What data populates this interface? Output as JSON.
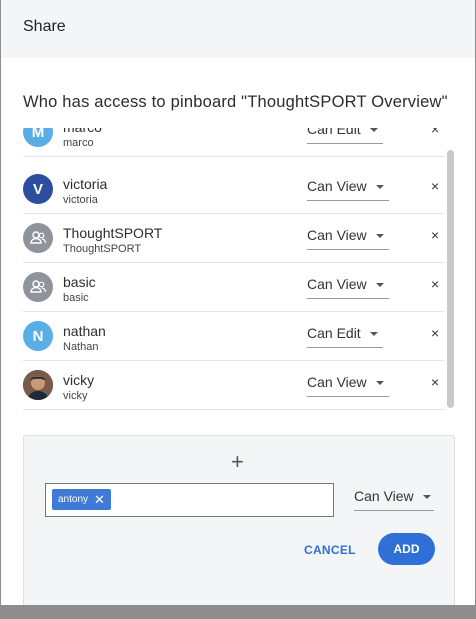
{
  "header": {
    "title": "Share"
  },
  "access_heading": "Who has access to  pinboard \"ThoughtSPORT Overview\"",
  "users": [
    {
      "name": "marco",
      "subname": "marco",
      "avatar_type": "initial",
      "initial": "M",
      "avatar_color": "#5aaee6",
      "permission": "Can Edit"
    },
    {
      "name": "victoria",
      "subname": "victoria",
      "avatar_type": "initial",
      "initial": "V",
      "avatar_color": "#2d4e9e",
      "permission": "Can View"
    },
    {
      "name": "ThoughtSPORT",
      "subname": "ThoughtSPORT",
      "avatar_type": "group-icon",
      "avatar_color": "#8f949c",
      "permission": "Can View"
    },
    {
      "name": "basic",
      "subname": "basic",
      "avatar_type": "group-icon",
      "avatar_color": "#8f949c",
      "permission": "Can View"
    },
    {
      "name": "nathan",
      "subname": "Nathan",
      "avatar_type": "initial",
      "initial": "N",
      "avatar_color": "#5aaee6",
      "permission": "Can Edit"
    },
    {
      "name": "vicky",
      "subname": "vicky",
      "avatar_type": "photo",
      "avatar_color": "#6b4a3a",
      "permission": "Can View"
    }
  ],
  "remove_glyph": "×",
  "add_panel": {
    "plus_glyph": "+",
    "chip_label": "antony",
    "chip_remove_glyph": "✕",
    "permission": "Can View",
    "cancel_label": "CANCEL",
    "add_label": "ADD"
  },
  "colors": {
    "accent": "#2f6fd6"
  }
}
